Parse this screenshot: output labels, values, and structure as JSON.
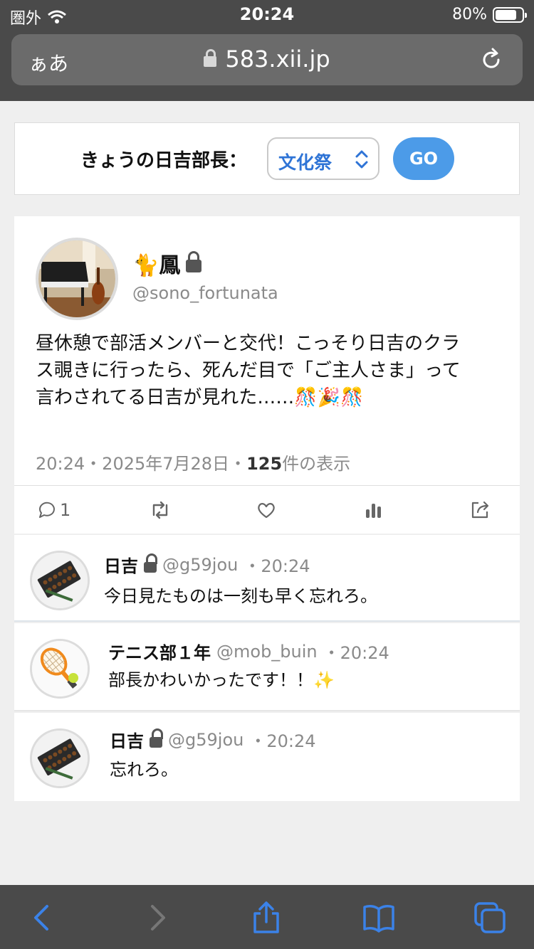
{
  "status": {
    "carrier": "圏外",
    "time": "20:24",
    "battery": "80%",
    "battery_level": 0.8
  },
  "browser": {
    "text_size": "ぁあ",
    "url": "583.xii.jp"
  },
  "selector": {
    "label": "きょうの日吉部長：",
    "selected": "文化祭",
    "go": "GO"
  },
  "tweet": {
    "name": "🐈鳳",
    "handle": "@sono_fortunata",
    "text": "昼休憩で部活メンバーと交代！こっそり日吉のクラス覗きに行ったら、死んだ目で「ご主人さま」って言わされてる日吉が見れた……🎊🎉🎊",
    "time": "20:24",
    "sep": "・",
    "date": "2025年7月28日",
    "views_count": "125",
    "views_label": "件の表示",
    "reply_count": "1"
  },
  "replies": [
    {
      "name": "日吉",
      "handle": "@g59jou",
      "time": "・20:24",
      "text": "今日見たものは一刻も早く忘れろ。"
    },
    {
      "name": "テニス部１年",
      "handle": "@mob_buin",
      "time": "・20:24",
      "text": "部長かわいかったです！！✨"
    },
    {
      "name": "日吉",
      "handle": "@g59jou",
      "time": "・20:24",
      "text": "忘れろ。"
    }
  ],
  "colors": {
    "accent": "#2f74d6",
    "go_button": "#4c9be8",
    "chrome": "#4a4a4a"
  }
}
